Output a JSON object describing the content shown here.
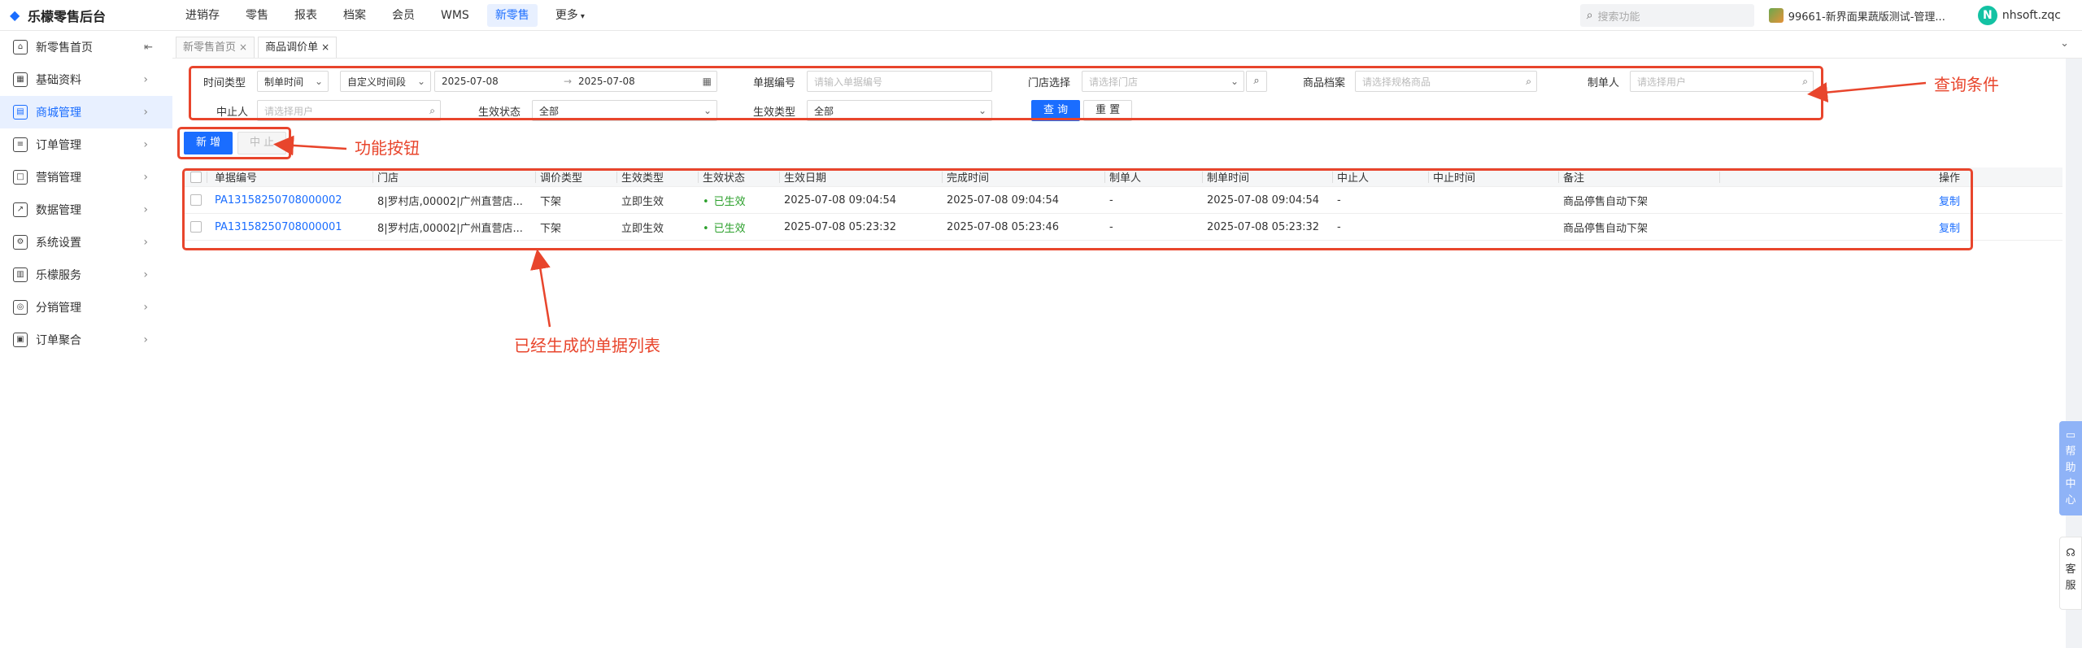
{
  "app": {
    "title": "乐檬零售后台"
  },
  "topnav": {
    "items": [
      {
        "label": "进销存"
      },
      {
        "label": "零售"
      },
      {
        "label": "报表"
      },
      {
        "label": "档案"
      },
      {
        "label": "会员"
      },
      {
        "label": "WMS"
      },
      {
        "label": "新零售"
      },
      {
        "label": "更多"
      }
    ],
    "active": "新零售",
    "search_placeholder": "搜索功能",
    "store": "99661-新界面果蔬版测试-管理...",
    "user_initial": "N",
    "user_name": "nhsoft.zqc"
  },
  "sidebar": {
    "items": [
      {
        "label": "新零售首页"
      },
      {
        "label": "基础资料"
      },
      {
        "label": "商城管理"
      },
      {
        "label": "订单管理"
      },
      {
        "label": "营销管理"
      },
      {
        "label": "数据管理"
      },
      {
        "label": "系统设置"
      },
      {
        "label": "乐檬服务"
      },
      {
        "label": "分销管理"
      },
      {
        "label": "订单聚合"
      }
    ],
    "active": "商城管理"
  },
  "tabs": [
    {
      "label": "新零售首页"
    },
    {
      "label": "商品调价单"
    }
  ],
  "query": {
    "time_type_label": "时间类型",
    "time_type_value": "制单时间",
    "time_range_value": "自定义时间段",
    "date_start": "2025-07-08",
    "date_sep": "→",
    "date_end": "2025-07-08",
    "doc_no_label": "单据编号",
    "doc_no_placeholder": "请输入单据编号",
    "store_label": "门店选择",
    "store_placeholder": "请选择门店",
    "goods_label": "商品档案",
    "goods_placeholder": "请选择规格商品",
    "creator_label": "制单人",
    "creator_placeholder": "请选择用户",
    "stopper_label": "中止人",
    "stopper_placeholder": "请选择用户",
    "effect_status_label": "生效状态",
    "effect_status_value": "全部",
    "effect_type_label": "生效类型",
    "effect_type_value": "全部",
    "search_button": "查 询",
    "reset_button": "重 置"
  },
  "actions": {
    "add_button": "新 增",
    "stop_button": "中 止"
  },
  "table": {
    "headers": [
      "单据编号",
      "门店",
      "调价类型",
      "生效类型",
      "生效状态",
      "生效日期",
      "完成时间",
      "制单人",
      "制单时间",
      "中止人",
      "中止时间",
      "备注",
      "操作"
    ],
    "rows": [
      {
        "doc_no": "PA13158250708000002",
        "store": "8|罗村店,00002|广州直营店...",
        "adjust_type": "下架",
        "effect_type": "立即生效",
        "effect_status": "已生效",
        "effect_date": "2025-07-08 09:04:54",
        "finish_time": "2025-07-08 09:04:54",
        "creator": "-",
        "create_time": "2025-07-08 09:04:54",
        "stopper": "-",
        "stop_time": "",
        "remark": "商品停售自动下架",
        "action": "复制"
      },
      {
        "doc_no": "PA13158250708000001",
        "store": "8|罗村店,00002|广州直营店...",
        "adjust_type": "下架",
        "effect_type": "立即生效",
        "effect_status": "已生效",
        "effect_date": "2025-07-08 05:23:32",
        "finish_time": "2025-07-08 05:23:46",
        "creator": "-",
        "create_time": "2025-07-08 05:23:32",
        "stopper": "-",
        "stop_time": "",
        "remark": "商品停售自动下架",
        "action": "复制"
      }
    ]
  },
  "annotations": {
    "query_conditions": "查询条件",
    "function_buttons": "功能按钮",
    "doc_list": "已经生成的单据列表"
  },
  "float": {
    "help": [
      "帮",
      "助",
      "中",
      "心"
    ],
    "kefu": [
      "客",
      "服"
    ]
  },
  "colors": {
    "accent": "#1a6dff",
    "annotation": "#e8452c",
    "success": "#2ca02c"
  }
}
